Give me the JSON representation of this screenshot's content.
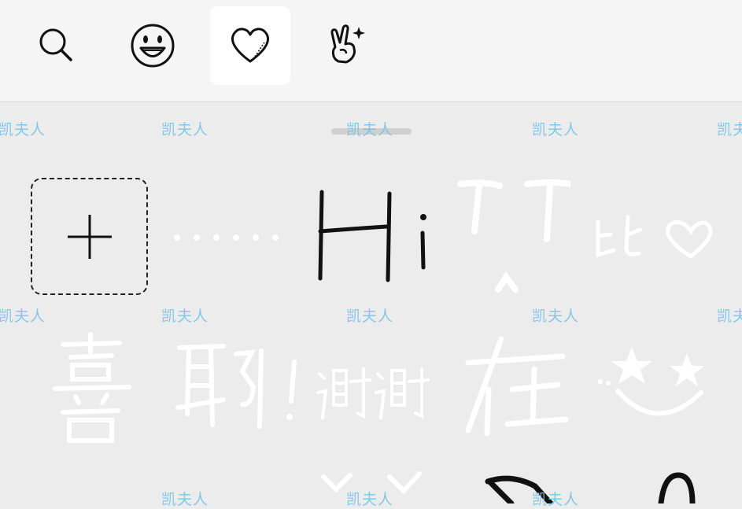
{
  "toolbar": {
    "tabs": [
      {
        "name": "search",
        "icon": "search-icon"
      },
      {
        "name": "emoji",
        "icon": "smiley-icon"
      },
      {
        "name": "favorites",
        "icon": "heart-icon",
        "active": true
      },
      {
        "name": "gestures",
        "icon": "victory-hand-sparkle-icon"
      }
    ]
  },
  "stickers": {
    "add_tile_icon": "plus-icon",
    "row1": [
      {
        "name": "dots-sticker",
        "text": "......"
      },
      {
        "name": "hi-sticker",
        "text": "Hi"
      },
      {
        "name": "cry-face-sticker",
        "text": "T ^ T"
      },
      {
        "name": "bi-heart-sticker",
        "text": "比♡"
      }
    ],
    "row2": [
      {
        "name": "xi-sticker",
        "text": "喜"
      },
      {
        "name": "ye-sticker",
        "text": "耶!"
      },
      {
        "name": "xiexie-sticker",
        "text": "谢谢"
      },
      {
        "name": "zai-sticker",
        "text": "在"
      },
      {
        "name": "star-smile-sticker",
        "text": "★ ★"
      }
    ]
  },
  "watermark": "凯夫人",
  "colors": {
    "toolbar_bg": "#f5f5f5",
    "panel_bg": "#ececec",
    "active_tab_bg": "#ffffff",
    "watermark": "#7cc4e8"
  }
}
